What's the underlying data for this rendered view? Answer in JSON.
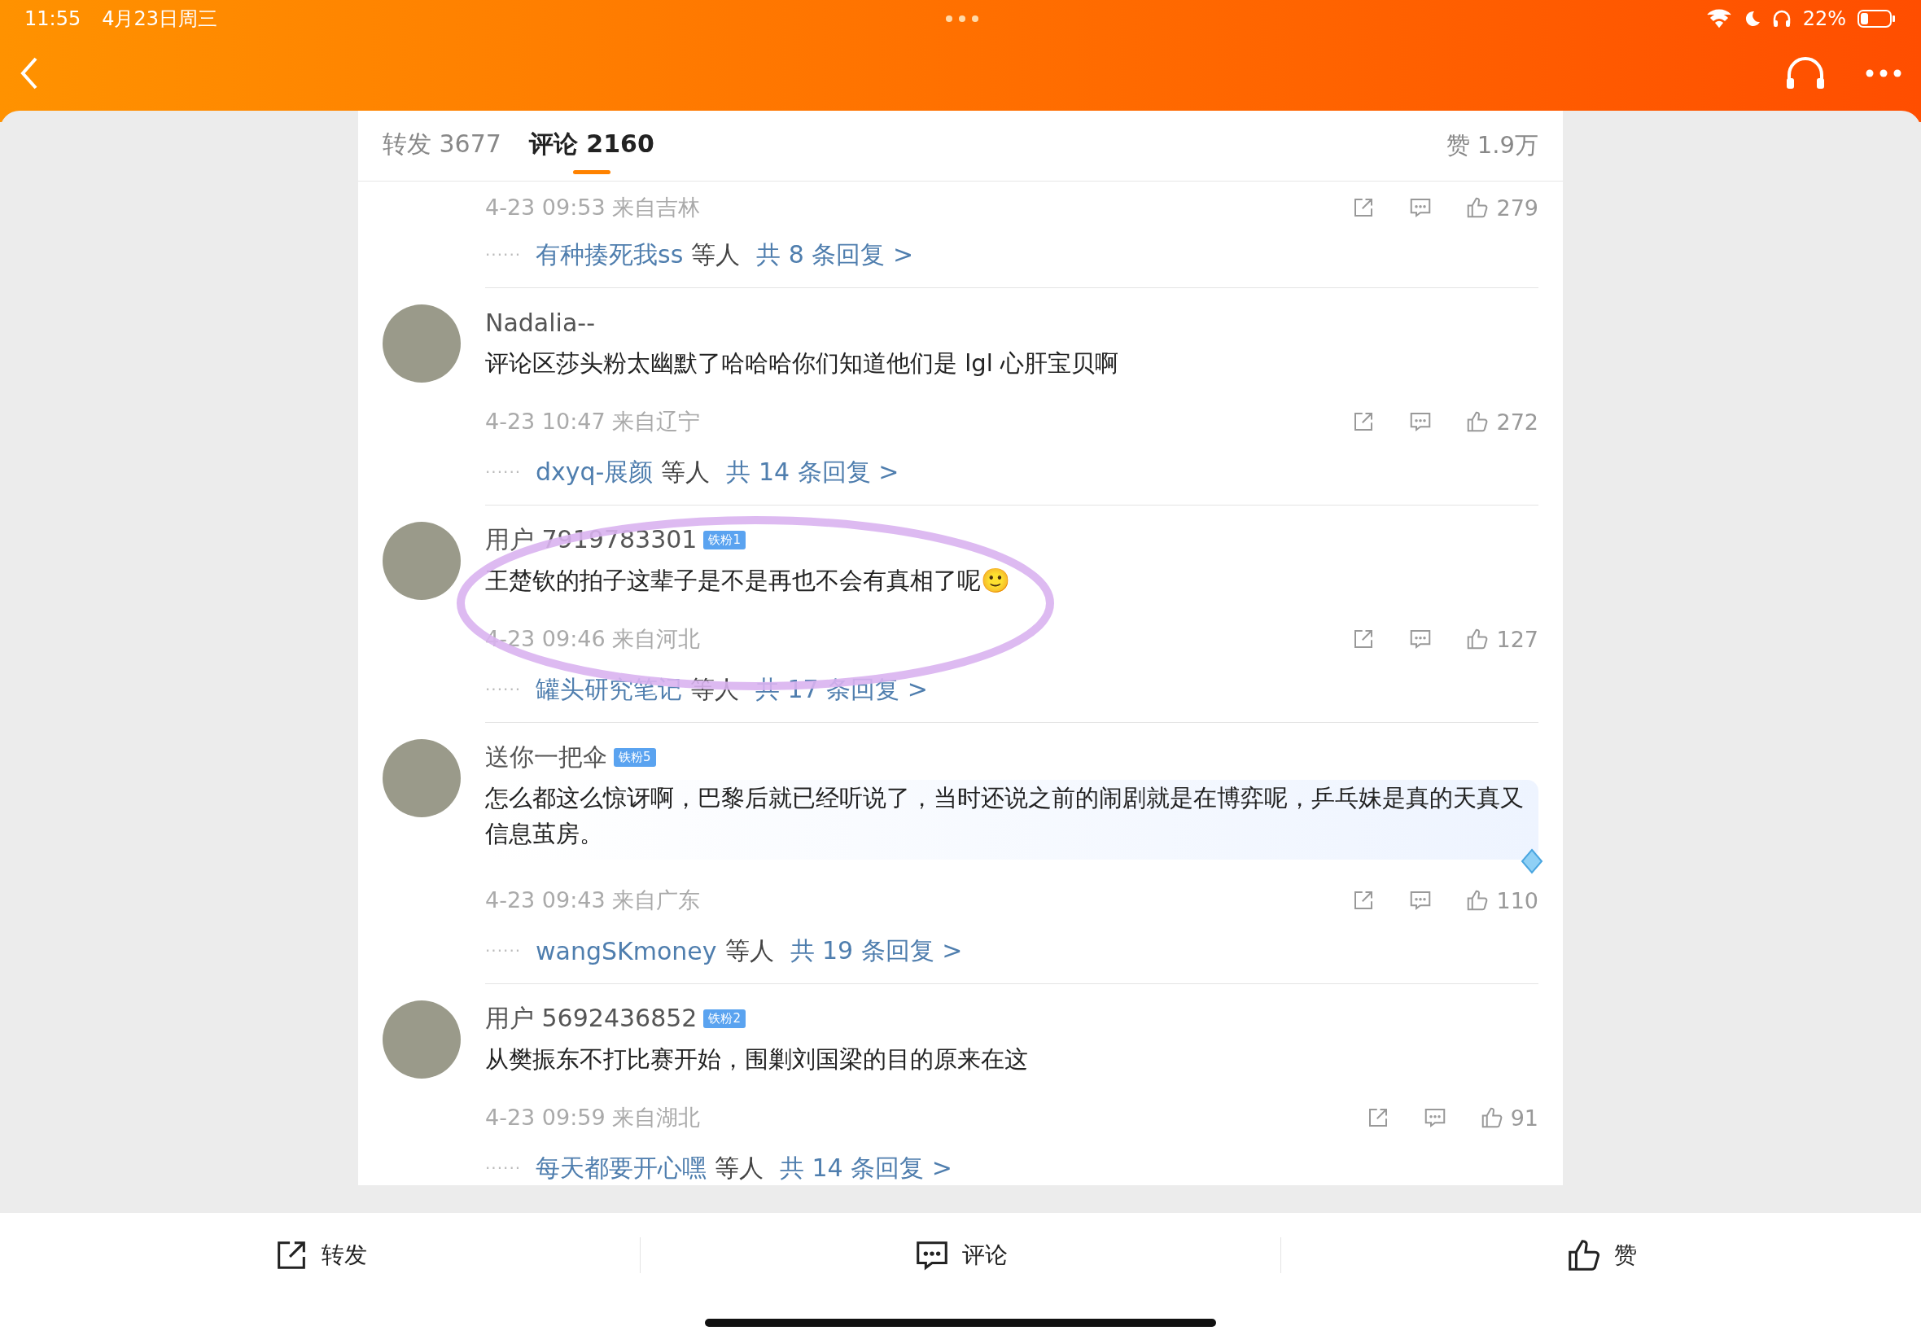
{
  "status_bar": {
    "time": "11:55",
    "date": "4月23日周三",
    "battery": "22%"
  },
  "tabs": [
    {
      "label": "转发 3677",
      "selected": false
    },
    {
      "label": "评论 2160",
      "selected": true
    }
  ],
  "likes_total": "赞 1.9万",
  "reply_dots": "······",
  "comments": [
    {
      "meta": "4-23 09:53 来自吉林",
      "likes": "279",
      "reply_users": "有种揍死我ss",
      "reply_suffix": "等人",
      "reply_count": "共 8 条回复 >"
    },
    {
      "name": "Nadalia--",
      "avatar": true,
      "text": "评论区莎头粉太幽默了哈哈哈你们知道他们是 lgl 心肝宝贝啊",
      "meta": "4-23 10:47 来自辽宁",
      "likes": "272",
      "reply_users": "dxyq-展颜",
      "reply_suffix": "等人",
      "reply_count": "共 14 条回复 >"
    },
    {
      "name": "用户 7919783301",
      "badge": "铁粉1",
      "avatar": true,
      "text": "王楚钦的拍子这辈子是不是再也不会有真相了呢",
      "emoji": "🙂",
      "circled": true,
      "meta": "4-23 09:46 来自河北",
      "likes": "127",
      "reply_users": "罐头研究笔记",
      "reply_suffix": "等人",
      "reply_count": "共 17 条回复 >"
    },
    {
      "name": "送你一把伞",
      "badge": "铁粉5",
      "avatar": true,
      "text": "怎么都这么惊讶啊，巴黎后就已经听说了，当时还说之前的闹剧就是在博弈呢，乒乓妹是真的天真又信息茧房。",
      "highlighted": true,
      "meta": "4-23 09:43 来自广东",
      "likes": "110",
      "reply_users": "wangSKmoney",
      "reply_suffix": "等人",
      "reply_count": "共 19 条回复 >"
    },
    {
      "name": "用户 5692436852",
      "badge": "铁粉2",
      "avatar": true,
      "text": "从樊振东不打比赛开始，围剿刘国梁的目的原来在这",
      "meta": "4-23 09:59 来自湖北",
      "likes": "91",
      "reply_users": "每天都要开心嘿",
      "reply_suffix": "等人",
      "reply_count": "共 14 条回复 >"
    }
  ],
  "actions": [
    {
      "kind": "repost",
      "label": "转发"
    },
    {
      "kind": "comment",
      "label": "评论"
    },
    {
      "kind": "like",
      "label": "赞"
    }
  ]
}
